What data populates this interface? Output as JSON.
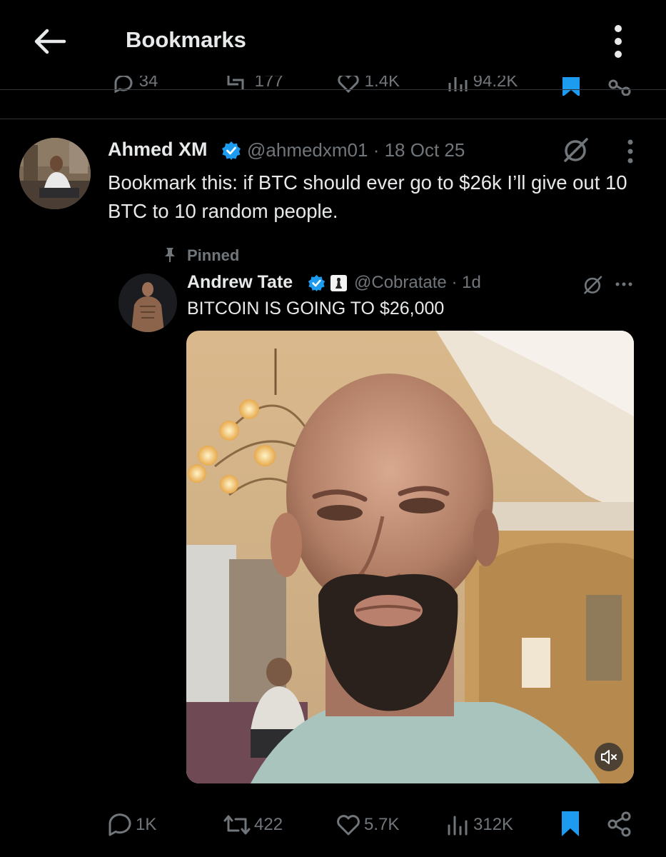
{
  "header": {
    "title": "Bookmarks",
    "back_icon": "arrow-left-icon",
    "more_icon": "vertical-dots-icon"
  },
  "previous_tweet_actions": {
    "replies": "34",
    "reposts": "177",
    "likes": "1.4K",
    "views": "94.2K"
  },
  "tweet": {
    "author_name": "Ahmed XM",
    "handle": "@ahmedxm01",
    "date": "· 18 Oct 25",
    "text": "Bookmark this: if BTC should ever go to $26k I’ll give out 10 BTC to 10 random people.",
    "verified": true,
    "grok_icon": "grok-icon",
    "more_icon": "vertical-dots-icon"
  },
  "quoted_tweet": {
    "pinned_label": "Pinned",
    "author_name": "Andrew Tate",
    "handle": "@Cobratate",
    "time": "· 1d",
    "text": "BITCOIN IS GOING TO $26,000",
    "media_type": "video",
    "mute_icon": "speaker-muted-icon"
  },
  "actions": {
    "replies": "1K",
    "reposts": "422",
    "likes": "5.7K",
    "views": "312K",
    "bookmarked": true
  },
  "colors": {
    "background": "#000000",
    "text_primary": "#e7e9ea",
    "text_secondary": "#71767b",
    "accent_blue": "#1d9bf0",
    "divider": "#2f3336"
  }
}
